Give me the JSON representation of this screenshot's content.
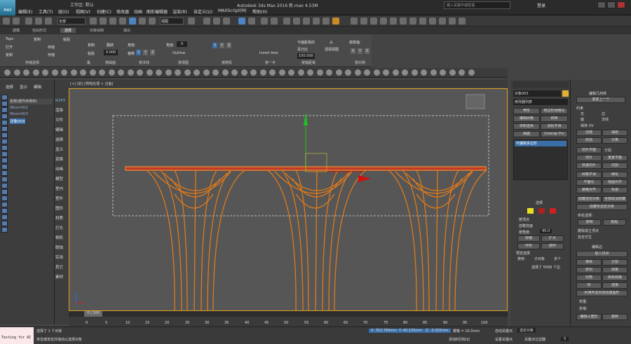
{
  "title": {
    "app": "Autodesk 3ds Max 2016",
    "file": "新.max",
    "mem": "4.53M",
    "workspace": "工作区: 默认",
    "search_placeholder": "键入关键字或短语",
    "login": "登录"
  },
  "menus": [
    "编辑(E)",
    "工具(T)",
    "组(G)",
    "视图(V)",
    "创建(C)",
    "修改器",
    "动画",
    "图形编辑器",
    "渲染(R)",
    "自定义(U)",
    "MAXScript(M)",
    "帮助(H)"
  ],
  "toolbar": {
    "filter": "全部",
    "view": "视图"
  },
  "ribbon": {
    "tabs": [
      "建模",
      "自由形式",
      "选择",
      "对象绘制",
      "填充"
    ],
    "tops": "Tops",
    "copy": "复制",
    "open": "打开",
    "paste": "粘贴",
    "save": "存储",
    "copy2": "复制",
    "paste2": "粘贴",
    "flip": "翻转",
    "scale_val": "0.000",
    "bias": "偏移",
    "angle1": "角度:",
    "angle2": "角度:",
    "val1": "0",
    "outline": "Outline",
    "invert": "Invert Axis",
    "dist_label": "与轴距离的",
    "pct": "百分比",
    "val100": "100.000",
    "from": "从",
    "persp": "透视视图",
    "mirror": "镜像轴:",
    "xyz": [
      "X",
      "Y",
      "Z"
    ],
    "groups": [
      "存储选择",
      "集",
      "按曲面",
      "按法线",
      "按视图",
      "按随机",
      "按一半",
      "按轴距离",
      "按对称"
    ]
  },
  "scene_tabs": [
    "选择",
    "显示",
    "编辑"
  ],
  "scene_header": "名称(按升序排序)",
  "objects": [
    "Woon002",
    "Woon003",
    "对象003"
  ],
  "cmd_panel": [
    "R2P3",
    "渲染",
    "文件",
    "编辑",
    "选择",
    "显示",
    "变换",
    "动画",
    "模型",
    "室内",
    "室外",
    "图形",
    "材质",
    "灯光",
    "相机",
    "脱烛",
    "实用",
    "其它",
    "素材"
  ],
  "viewport": {
    "label": "[+] [前] [明暗处理 + 边面]",
    "frame": "0 / 100"
  },
  "modify": {
    "object_name": "对象003",
    "modifier_list": "修改器列表",
    "buttons": [
      "壳形",
      "四边形网格化",
      "编辑网格",
      "转换",
      "体积选择",
      "涡轮平滑",
      "曲面",
      "Unwrap Pro"
    ],
    "stack_item": "可编辑多边形",
    "rollout_select": "选择",
    "by_vertex": "按顶点",
    "ignore_back": "忽略背面",
    "angle_label": "按角度:",
    "angle_val": "45.0",
    "shrink": "收缩",
    "grow": "扩大",
    "ring": "环形",
    "loop": "循环",
    "preview": "预览选择",
    "disable": "禁用",
    "subobject": "子对象",
    "multi": "多个",
    "status": "选择了 5566 个边"
  },
  "edit_geom": {
    "title": "编辑几何体",
    "repeat": "重复上一个",
    "constraint": "约束",
    "none": "无",
    "edge": "边",
    "face": "面",
    "normal": "法线",
    "keep_uv": "保持 UV",
    "create": "创建",
    "collapse": "塌陷",
    "attach": "附加",
    "detach": "分离",
    "slice_plane": "切片平面",
    "split": "分割",
    "slice": "切片",
    "reset_plane": "重置平面",
    "quickslice": "快速切片",
    "cut": "切割",
    "meshsmooth": "网格平滑",
    "tessellate": "细化",
    "make_planar": "平面化",
    "view_align": "视图对齐",
    "grid_align": "栅格对齐",
    "relax": "松弛",
    "hide_sel": "隐藏选定对象",
    "unhide_all": "全部取消隐藏",
    "hide_unsel": "隐藏未选定对象",
    "named_sel": "命名选择:",
    "copy": "复制",
    "paste": "粘贴",
    "delete_iso": "删除孤立顶点",
    "full_interact": "完全交互"
  },
  "edit_edges": {
    "title": "编辑边",
    "insert": "插入顶点",
    "remove": "移除",
    "split": "分割",
    "extrude": "挤出",
    "weld": "焊接",
    "chamfer": "切角",
    "target_weld": "目标焊接",
    "bridge": "桥",
    "connect": "连接",
    "create_shape": "利用所选内容创建图形",
    "weight": "权重:",
    "crease": "折缝:",
    "edit_tri": "编辑三角形",
    "turn": "旋转"
  },
  "timeline": {
    "ticks": [
      "0",
      "5",
      "10",
      "15",
      "20",
      "25",
      "30",
      "35",
      "40",
      "45",
      "50",
      "55",
      "60",
      "65",
      "70",
      "75",
      "80",
      "85",
      "90",
      "95",
      "100"
    ]
  },
  "status": {
    "selected": "选择了 1 个对象",
    "prompt": "单击或单击并拖动以选择对象",
    "script": "Testing for AI",
    "x": "X: 352.769mm",
    "y": "Y: 40.135mm",
    "z": "Z: -3.302mm",
    "grid": "栅格 = 10.0mm",
    "autokey": "自动关键点",
    "selobj": "选定对象",
    "setkey": "设置关键点",
    "keyfilter": "关键点过滤器",
    "addtime": "添加时间标记",
    "frame": "0"
  }
}
